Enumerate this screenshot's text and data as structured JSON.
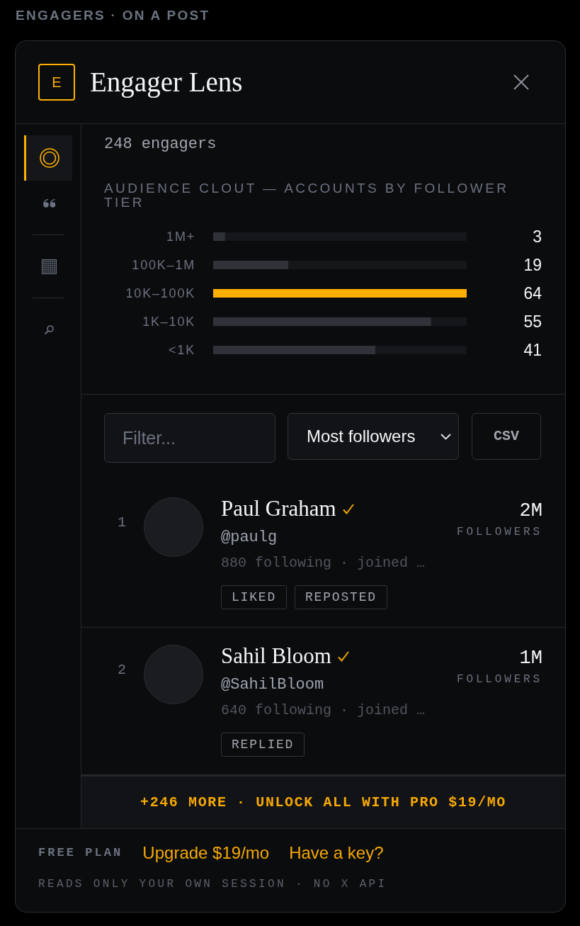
{
  "caption": "ENGAGERS · ON A POST",
  "header": {
    "logo_letter": "E",
    "title": "Engager Lens"
  },
  "sidebar": {
    "groups": [
      {
        "items": [
          {
            "kind": "rings",
            "selected": true
          },
          {
            "kind": "quote",
            "selected": false
          }
        ]
      },
      {
        "items": [
          {
            "kind": "grid",
            "selected": false
          }
        ]
      },
      {
        "items": [
          {
            "kind": "search",
            "selected": false
          }
        ]
      }
    ]
  },
  "audience": {
    "summary": "248 engagers",
    "chart_data": {
      "type": "bar",
      "orientation": "horizontal",
      "title": "AUDIENCE CLOUT — ACCOUNTS BY FOLLOWER TIER",
      "categories": [
        "1M+",
        "100K–1M",
        "10K–100K",
        "1K–10K",
        "<1K"
      ],
      "values": [
        3,
        19,
        64,
        55,
        41
      ],
      "data_labels": true
    }
  },
  "controls": {
    "filter": {
      "placeholder": "Filter..."
    },
    "sort": {
      "value": "Most followers"
    },
    "export_button": "CSV"
  },
  "engagers": [
    {
      "rank": "1",
      "name": "Paul Graham",
      "verified": true,
      "handle": "@paulg",
      "meta": "880 following · joined …",
      "followers": "2M",
      "followers_label": "FOLLOWERS",
      "tags": [
        "LIKED",
        "REPOSTED"
      ]
    },
    {
      "rank": "2",
      "name": "Sahil Bloom",
      "verified": true,
      "handle": "@SahilBloom",
      "meta": "640 following · joined …",
      "followers": "1M",
      "followers_label": "FOLLOWERS",
      "tags": [
        "REPLIED"
      ]
    }
  ],
  "unlock_banner": "+246 MORE · UNLOCK ALL WITH PRO $19/MO",
  "footer": {
    "plan": "FREE PLAN",
    "links": [
      "Upgrade $19/mo",
      "Have a key?"
    ],
    "note": "READS ONLY YOUR OWN SESSION · NO X API"
  }
}
